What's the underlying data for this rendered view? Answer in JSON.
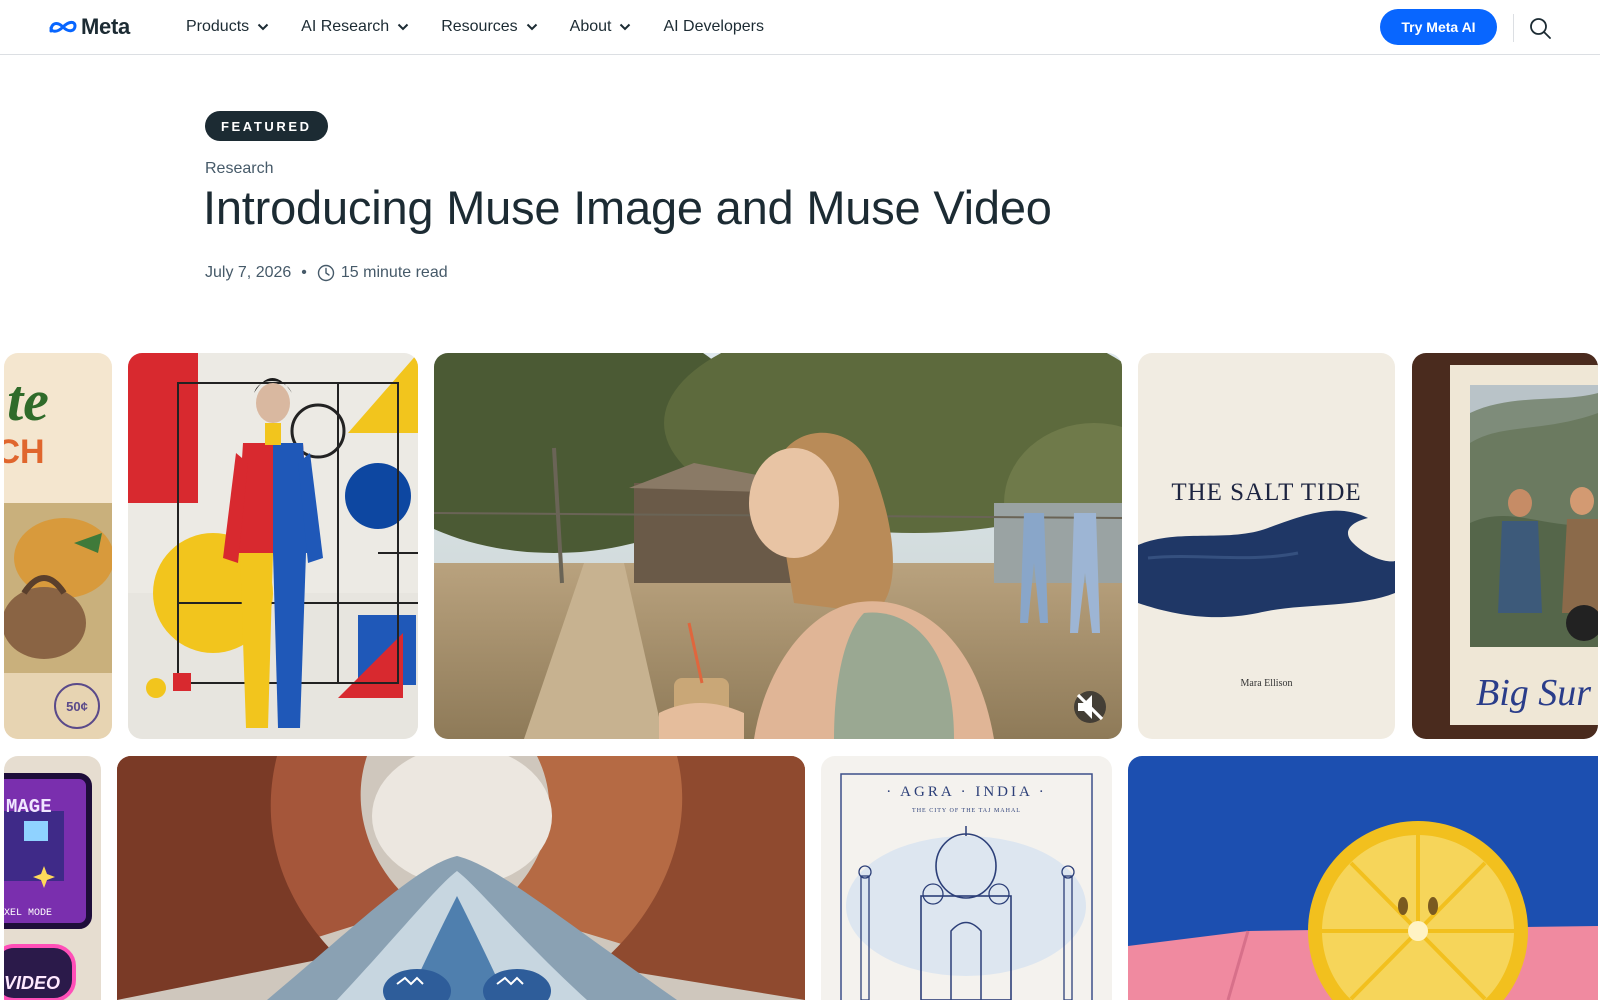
{
  "nav": {
    "logo_text": "Meta",
    "menu": [
      {
        "label": "Products",
        "has_dropdown": true
      },
      {
        "label": "AI Research",
        "has_dropdown": true
      },
      {
        "label": "Resources",
        "has_dropdown": true
      },
      {
        "label": "About",
        "has_dropdown": true
      },
      {
        "label": "AI Developers",
        "has_dropdown": false
      }
    ],
    "cta_label": "Try Meta AI",
    "search_icon": "search-icon"
  },
  "article": {
    "badge": "FEATURED",
    "category": "Research",
    "title": "Introducing Muse Image and Muse Video",
    "date": "July 7, 2026",
    "separator": "•",
    "read_time": "15 minute read"
  },
  "gallery": {
    "cards": {
      "salt_tide": {
        "title": "THE SALT TIDE",
        "author": "Mara Ellison"
      },
      "big_sur": {
        "caption": "Big Sur"
      },
      "agra": {
        "title": "· AGRA · INDIA ·",
        "subtitle": "THE CITY OF THE TAJ MAHAL"
      },
      "state_poster": {
        "line1": "te",
        "line2": "CH",
        "stamp": "50¢"
      },
      "pixel_patch": {
        "line1": "MAGE",
        "line2": "XEL MODE",
        "line3": "VIDEO"
      }
    },
    "video_control_icon": "mute-icon"
  },
  "colors": {
    "accent": "#0866ff",
    "text": "#1c2b33",
    "muted": "#465a69",
    "badge_bg": "#1c2b33"
  }
}
